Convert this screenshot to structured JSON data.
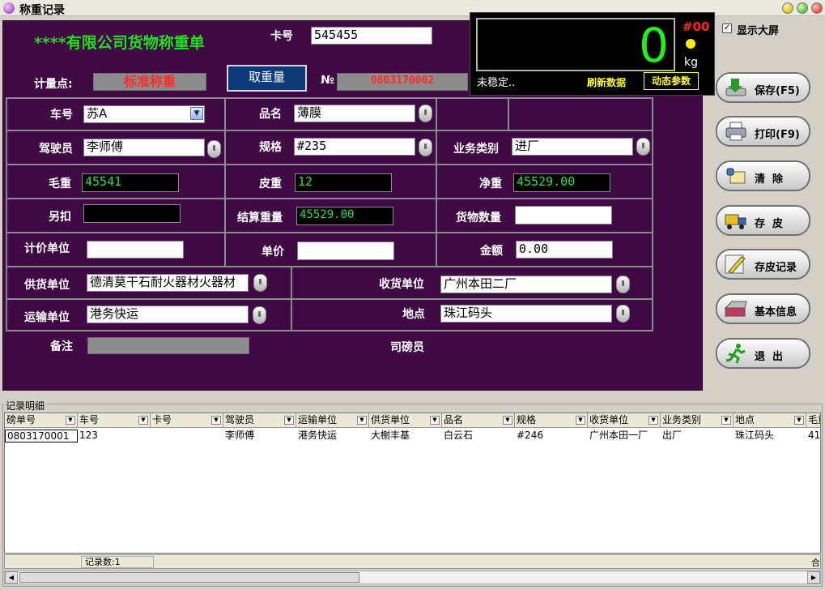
{
  "window": {
    "title": "称重记录"
  },
  "header": {
    "company": "****有限公司货物称重单",
    "card_label": "卡号",
    "card_value": "545455",
    "site_label": "计量点:",
    "site_value": "标准称重",
    "weigh_button": "取重量",
    "no_label": "№",
    "no_value": "0803170002"
  },
  "display": {
    "weight": "0",
    "scale_id": "#00",
    "unit": "kg",
    "stable_text": "未稳定..",
    "refresh_label": "刷新数据",
    "dynamic_label": "动态参数"
  },
  "big_screen": {
    "checked": "✓",
    "label": "显示大屏"
  },
  "form": {
    "plate_label": "车号",
    "plate_value": "苏A",
    "product_label": "品名",
    "product_value": "薄膜",
    "driver_label": "驾驶员",
    "driver_value": "李师傅",
    "spec_label": "规格",
    "spec_value": "#235",
    "biz_label": "业务类别",
    "biz_value": "进厂",
    "gross_label": "毛重",
    "gross_value": "45541",
    "tare_label": "皮重",
    "tare_value": "12",
    "net_label": "净重",
    "net_value": "45529.00",
    "deduct_label": "另扣",
    "deduct_value": "",
    "settle_label": "结算重量",
    "settle_value": "45529.00",
    "qty_label": "货物数量",
    "qty_value": "",
    "unit_label": "计价单位",
    "unit_value": "",
    "price_label": "单价",
    "price_value": "",
    "amount_label": "金额",
    "amount_value": "0.00",
    "supplier_label": "供货单位",
    "supplier_value": "德清莫干石耐火器材火器材",
    "receiver_label": "收货单位",
    "receiver_value": "广州本田二厂",
    "carrier_label": "运输单位",
    "carrier_value": "港务快运",
    "location_label": "地点",
    "location_value": "珠江码头",
    "remark_label": "备注",
    "remark_value": "",
    "operator_label": "司磅员"
  },
  "side_buttons": {
    "save": "保存(F5)",
    "print": "打印(F9)",
    "clear": "清  除",
    "store_tare": "存  皮",
    "tare_records": "存皮记录",
    "basic_info": "基本信息",
    "exit": "退  出"
  },
  "grid": {
    "caption": "记录明细",
    "columns": [
      "磅单号",
      "车号",
      "卡号",
      "驾驶员",
      "运输单位",
      "供货单位",
      "品名",
      "规格",
      "收货单位",
      "业务类别",
      "地点",
      "毛重"
    ],
    "rows": [
      [
        "0803170001",
        "123",
        "",
        "李师傅",
        "港务快运",
        "大榭丰基",
        "白云石",
        "#246",
        "广州本田一厂",
        "出厂",
        "珠江码头",
        "41"
      ]
    ],
    "record_count": "记录数:1",
    "total_label": "合"
  }
}
